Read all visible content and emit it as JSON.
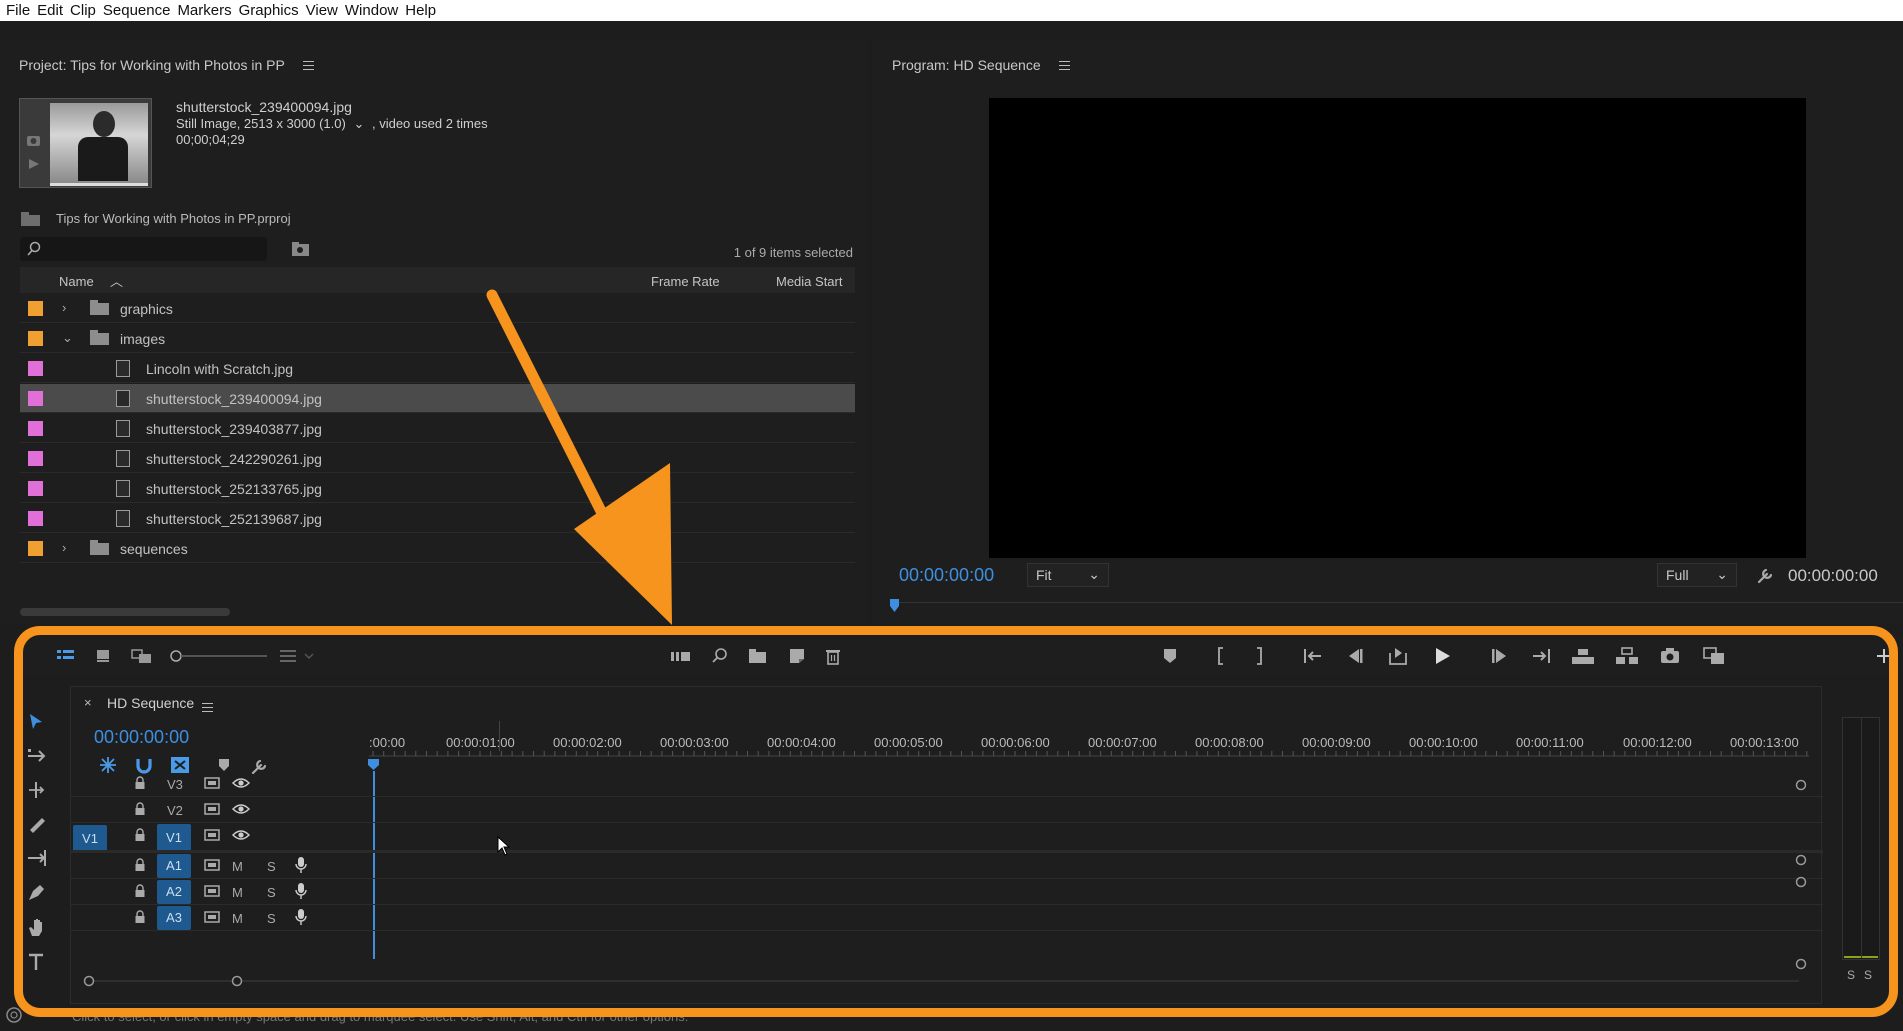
{
  "menu": [
    "File",
    "Edit",
    "Clip",
    "Sequence",
    "Markers",
    "Graphics",
    "View",
    "Window",
    "Help"
  ],
  "project": {
    "title": "Project: Tips for Working with Photos in PP",
    "selected_file": "shutterstock_239400094.jpg",
    "meta_line1": "Still Image, 2513 x 3000 (1.0)",
    "meta_line1b": ", video used 2 times",
    "meta_line2": "00;00;04;29",
    "project_file": "Tips for Working with Photos in PP.prproj",
    "items_count": "1 of 9 items selected",
    "columns": {
      "name": "Name",
      "frame_rate": "Frame Rate",
      "media_start": "Media Start"
    },
    "rows": [
      {
        "label": "graphics",
        "type": "folder",
        "expanded": false,
        "color": "#f0a030"
      },
      {
        "label": "images",
        "type": "folder",
        "expanded": true,
        "color": "#f0a030"
      },
      {
        "label": "Lincoln with Scratch.jpg",
        "type": "image",
        "color": "#e070d8"
      },
      {
        "label": "shutterstock_239400094.jpg",
        "type": "image",
        "color": "#e070d8",
        "selected": true
      },
      {
        "label": "shutterstock_239403877.jpg",
        "type": "image",
        "color": "#e070d8"
      },
      {
        "label": "shutterstock_242290261.jpg",
        "type": "image",
        "color": "#e070d8"
      },
      {
        "label": "shutterstock_252133765.jpg",
        "type": "image",
        "color": "#e070d8"
      },
      {
        "label": "shutterstock_252139687.jpg",
        "type": "image",
        "color": "#e070d8"
      },
      {
        "label": "sequences",
        "type": "folder",
        "expanded": false,
        "color": "#f0a030"
      }
    ]
  },
  "program": {
    "title": "Program: HD Sequence",
    "timecode_left": "00:00:00:00",
    "fit": "Fit",
    "quality": "Full",
    "timecode_right": "00:00:00:00"
  },
  "timeline": {
    "tab": "HD Sequence",
    "timecode": "00:00:00:00",
    "ruler": [
      ":00:00",
      "00:00:01:00",
      "00:00:02:00",
      "00:00:03:00",
      "00:00:04:00",
      "00:00:05:00",
      "00:00:06:00",
      "00:00:07:00",
      "00:00:08:00",
      "00:00:09:00",
      "00:00:10:00",
      "00:00:11:00",
      "00:00:12:00",
      "00:00:13:00"
    ],
    "video_tracks": [
      "V3",
      "V2",
      "V1"
    ],
    "source_patch": "V1",
    "audio_tracks": [
      "A1",
      "A2",
      "A3"
    ],
    "mute": "M",
    "solo": "S",
    "meter_solo": [
      "S",
      "S"
    ]
  },
  "status_text": "Click to select, or click in empty space and drag to marquee select. Use Shift, Alt, and Ctrl for other options.",
  "colors": {
    "accent_orange": "#f7941d",
    "timecode_blue": "#3f8fe0",
    "track_blue": "#1e5a8f"
  }
}
